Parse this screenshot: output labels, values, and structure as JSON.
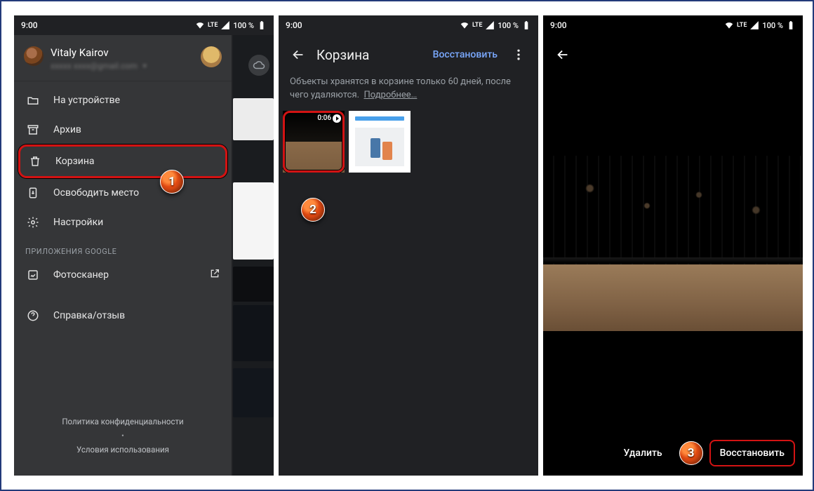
{
  "status": {
    "time": "9:00",
    "net": "LTE",
    "battery": "100 %"
  },
  "drawer": {
    "user_name": "Vitaly Kairov",
    "user_mail": "xxxxx xxxx@gmail.com",
    "items": {
      "device": "На устройстве",
      "archive": "Архив",
      "trash": "Корзина",
      "free": "Освободить место",
      "settings": "Настройки",
      "section": "ПРИЛОЖЕНИЯ GOOGLE",
      "scanner": "Фотосканер",
      "help": "Справка/отзыв"
    },
    "footer": {
      "privacy": "Политика конфиденциальности",
      "terms": "Условия использования"
    }
  },
  "trash": {
    "title": "Корзина",
    "action": "Восстановить",
    "info": "Объекты хранятся в корзине только 60 дней, после чего удаляются.",
    "more": "Подробнее…",
    "thumb1_duration": "0:06"
  },
  "viewer": {
    "delete": "Удалить",
    "restore": "Восстановить"
  },
  "steps": {
    "s1": "1",
    "s2": "2",
    "s3": "3"
  }
}
